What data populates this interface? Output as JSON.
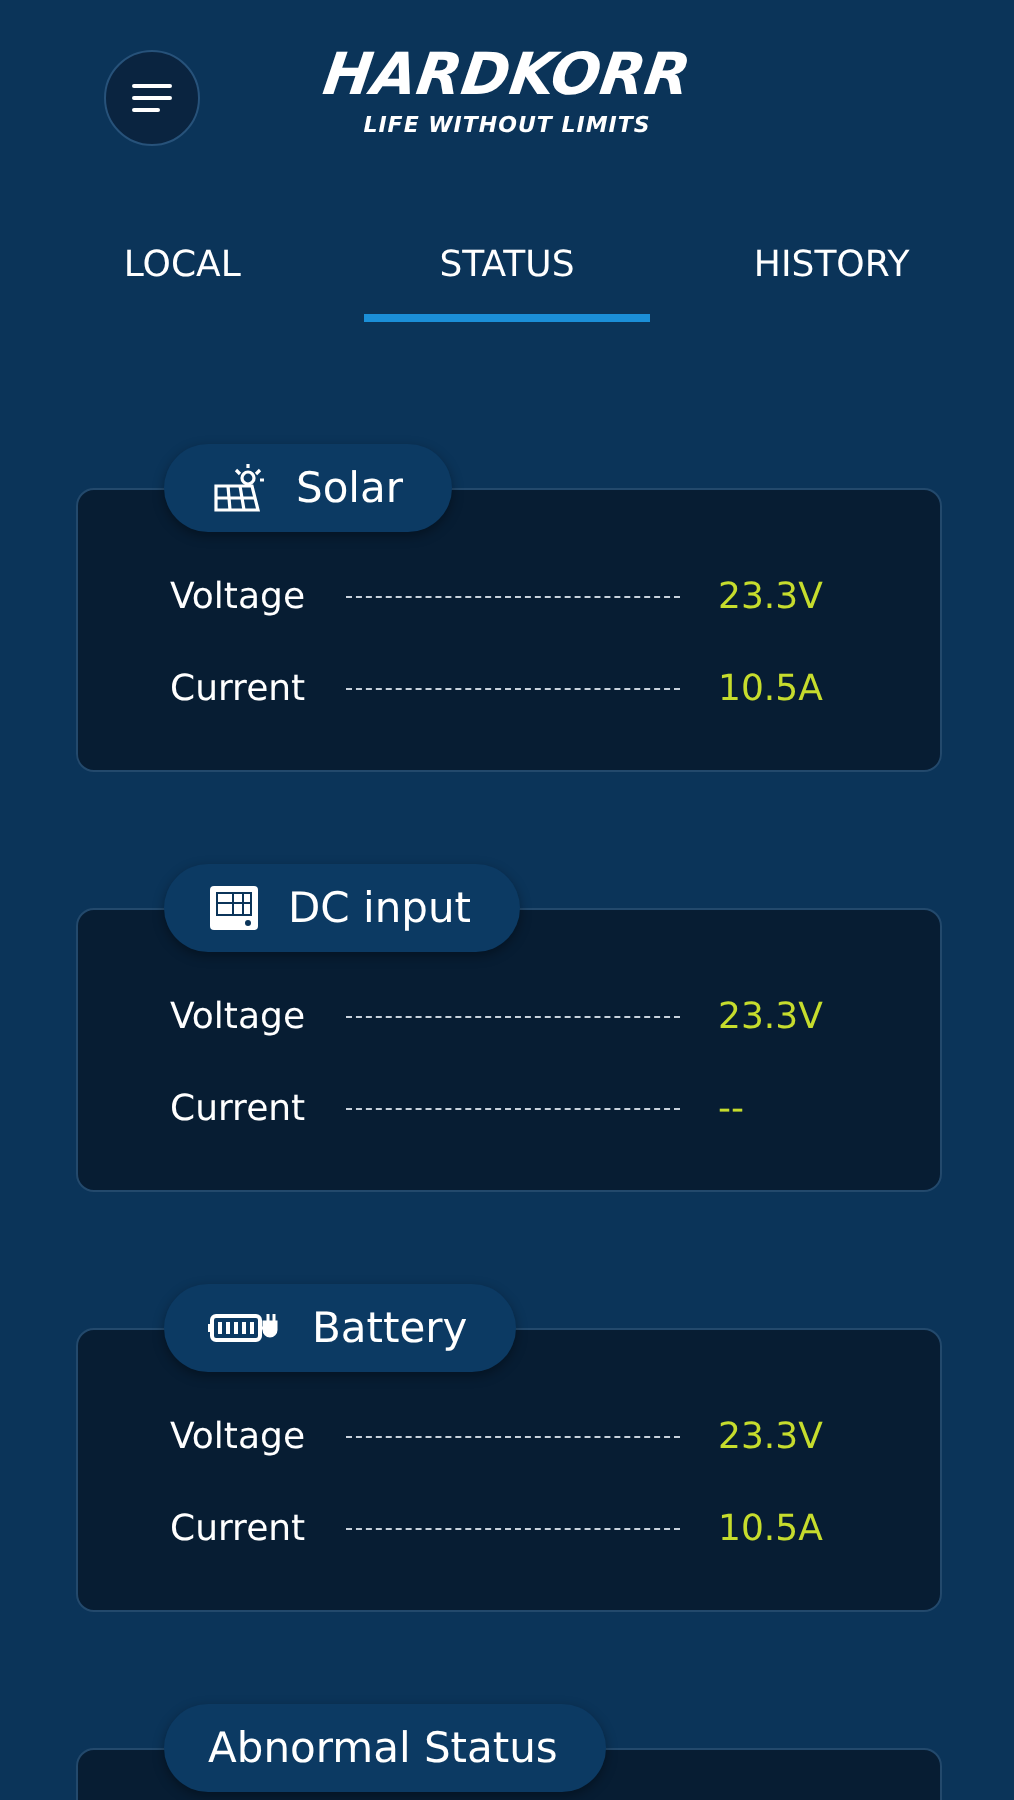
{
  "header": {
    "logo": "HARDKORR",
    "tagline": "LIFE WITHOUT LIMITS"
  },
  "tabs": [
    {
      "label": "LOCAL",
      "selected": false
    },
    {
      "label": "STATUS",
      "selected": true
    },
    {
      "label": "HISTORY",
      "selected": false
    }
  ],
  "sections": [
    {
      "title": "Solar",
      "kind": "solar",
      "rows": [
        {
          "label": "Voltage",
          "value": "23.3V"
        },
        {
          "label": "Current",
          "value": "10.5A"
        }
      ]
    },
    {
      "title": "DC input",
      "kind": "dc",
      "rows": [
        {
          "label": "Voltage",
          "value": "23.3V"
        },
        {
          "label": "Current",
          "value": "--"
        }
      ]
    },
    {
      "title": "Battery",
      "kind": "battery",
      "rows": [
        {
          "label": "Voltage",
          "value": "23.3V"
        },
        {
          "label": "Current",
          "value": "10.5A"
        }
      ]
    },
    {
      "title": "Abnormal Status",
      "kind": "plain"
    }
  ]
}
